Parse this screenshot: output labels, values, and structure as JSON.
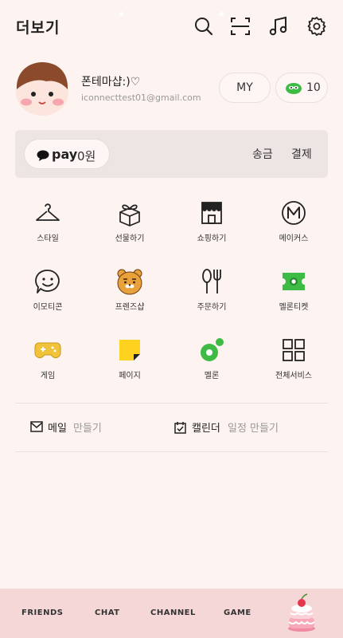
{
  "header": {
    "title": "더보기",
    "icons": [
      "search-icon",
      "scan-icon",
      "music-icon",
      "settings-icon"
    ]
  },
  "profile": {
    "name": "폰테마샵:)♡",
    "email": "iconnecttest01@gmail.com",
    "my_button": "MY",
    "coin_count": "10"
  },
  "pay": {
    "label": "pay",
    "amount": "0원",
    "send": "송금",
    "payment": "결제"
  },
  "services": [
    {
      "label": "스타일",
      "icon": "hanger-icon"
    },
    {
      "label": "선물하기",
      "icon": "gift-icon"
    },
    {
      "label": "쇼핑하기",
      "icon": "shop-icon"
    },
    {
      "label": "메이커스",
      "icon": "makers-icon"
    },
    {
      "label": "이모티콘",
      "icon": "emoticon-icon"
    },
    {
      "label": "프렌즈샵",
      "icon": "ryan-icon"
    },
    {
      "label": "주문하기",
      "icon": "fork-knife-icon"
    },
    {
      "label": "멜론티켓",
      "icon": "ticket-icon"
    },
    {
      "label": "게임",
      "icon": "gamepad-icon"
    },
    {
      "label": "페이지",
      "icon": "page-icon"
    },
    {
      "label": "멜론",
      "icon": "melon-icon"
    },
    {
      "label": "전체서비스",
      "icon": "grid-icon"
    }
  ],
  "quick": {
    "mail_bold": "메일",
    "mail_gray": "만들기",
    "calendar_bold": "캘린더",
    "calendar_gray": "일정 만들기"
  },
  "tabs": [
    "FRIENDS",
    "CHAT",
    "CHANNEL",
    "GAME"
  ],
  "colors": {
    "background": "#fdf3f1",
    "tabbar": "#f6d7d8",
    "pay_bar": "#ede5e3",
    "melon_green": "#3dbb45"
  }
}
